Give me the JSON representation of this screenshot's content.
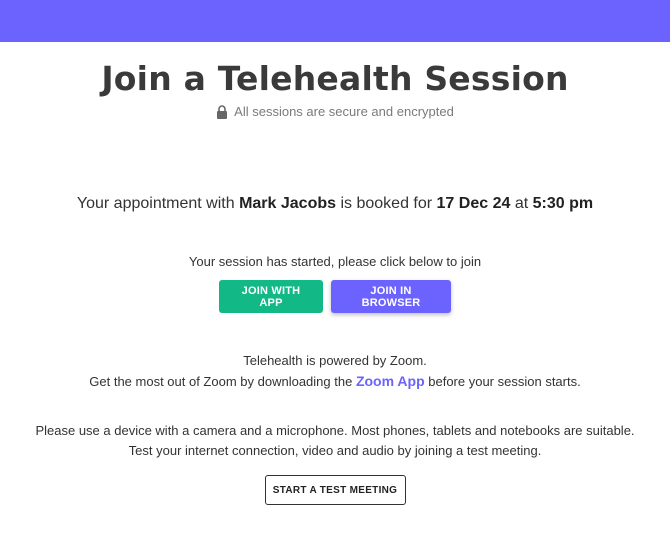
{
  "header": {
    "accent_color": "#6c63ff"
  },
  "title": "Join a Telehealth Session",
  "secure_note": {
    "icon": "lock-icon",
    "text": "All sessions are secure and encrypted"
  },
  "appointment": {
    "prefix": "Your appointment with",
    "provider": "Mark Jacobs",
    "middle": "is booked for",
    "date": "17 Dec 24",
    "at": "at",
    "time": "5:30 pm"
  },
  "session_status": "Your session has started, please click below to join",
  "buttons": {
    "join_app": "JOIN WITH APP",
    "join_browser": "JOIN IN BROWSER",
    "test_meeting": "START A TEST MEETING"
  },
  "powered": {
    "line1": "Telehealth is powered by Zoom.",
    "line2_prefix": "Get the most out of Zoom by downloading the",
    "link": "Zoom App",
    "line2_suffix": "before your session starts."
  },
  "device_note": {
    "line1": "Please use a device with a camera and a microphone. Most phones, tablets and notebooks are suitable.",
    "line2": "Test your internet connection, video and audio by joining a test meeting."
  },
  "colors": {
    "brand": "#6c63ff",
    "success": "#12b886"
  }
}
